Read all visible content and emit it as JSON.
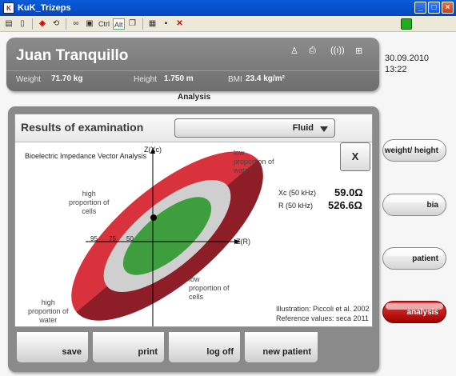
{
  "window": {
    "title": "KuK_Trizeps"
  },
  "toolbar": {
    "ctrl": "Ctrl",
    "alt": "Alt"
  },
  "patient": {
    "name": "Juan Tranquillo",
    "weight_label": "Weight",
    "weight_value": "71.70 kg",
    "height_label": "Height",
    "height_value": "1.750 m",
    "bmi_label": "BMI",
    "bmi_value": "23.4 kg/m²"
  },
  "datetime": {
    "date": "30.09.2010",
    "time": "13:22"
  },
  "section_label": "Analysis",
  "results": {
    "title": "Results of examination",
    "dropdown_value": "Fluid",
    "close_label": "X",
    "chart_title": "Bioelectric Impedance Vector Analysis",
    "axis_y": "Z(Xc)",
    "axis_x": "Z(R)",
    "percentiles": [
      "95",
      "75",
      "50"
    ],
    "annotations": {
      "low_water": "low\nproportion of\nwater",
      "high_cells": "high\nproportion of\ncells",
      "low_cells": "low\nproportion of\ncells",
      "high_water": "high\nproportion of\nwater"
    },
    "xc_label": "Xc (50 kHz)",
    "xc_value": "59.0Ω",
    "r_label": "R (50 kHz)",
    "r_value": "526.6Ω",
    "credit1": "Illustration: Piccoli et al. 2002",
    "credit2": "Reference values: seca 2011"
  },
  "bottom_buttons": [
    "save",
    "print",
    "log off",
    "new patient"
  ],
  "side_buttons": [
    "weight/ height",
    "bia",
    "patient",
    "analysis"
  ],
  "colors": {
    "active": "#c00000",
    "panel": "#8a8a8a",
    "ring95": "#9e1f2a",
    "ring75": "#c8c8c8",
    "ring50": "#3a9a3a"
  }
}
